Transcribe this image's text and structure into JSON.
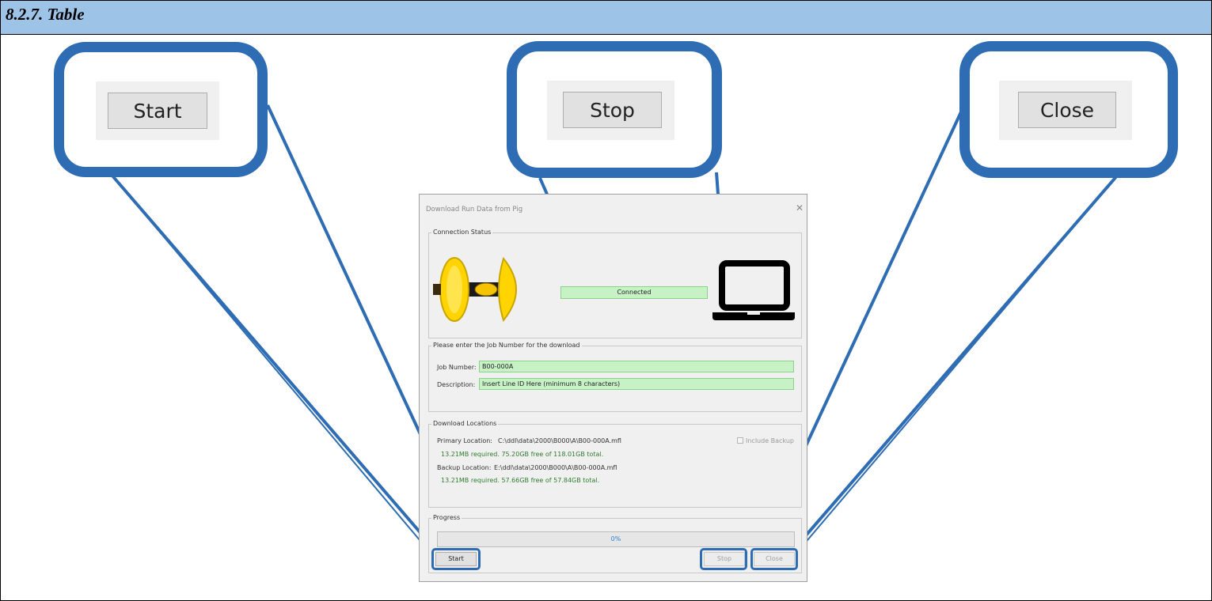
{
  "document": {
    "section_title": "8.2.7. Table"
  },
  "callouts": {
    "start": {
      "button_label": "Start"
    },
    "stop": {
      "button_label": "Stop"
    },
    "close": {
      "button_label": "Close"
    }
  },
  "dialog": {
    "title": "Download Run Data from Pig",
    "close_glyph": "✕",
    "connection": {
      "group_label": "Connection Status",
      "status": "Connected",
      "device_icon": "pig-device-image",
      "computer_icon": "laptop-icon"
    },
    "job": {
      "group_label": "Please enter the Job Number for the download",
      "job_number_label": "Job Number:",
      "job_number_value": "B00-000A",
      "description_label": "Description:",
      "description_value": "Insert Line ID Here (minimum 8 characters)"
    },
    "locations": {
      "group_label": "Download Locations",
      "primary_label": "Primary Location:",
      "primary_path": "C:\\ddl\\data\\2000\\B000\\A\\B00-000A.mfl",
      "primary_space": "13.21MB required. 75.20GB free of 118.01GB total.",
      "include_backup_label": "Include Backup",
      "include_backup_checked": false,
      "backup_label": "Backup Location:",
      "backup_path": "E:\\ddl\\data\\2000\\B000\\A\\B00-000A.mfl",
      "backup_space": "13.21MB required. 57.66GB free of 57.84GB total."
    },
    "progress": {
      "group_label": "Progress",
      "percent_text": "0%",
      "fill_fraction": 0
    },
    "buttons": {
      "start": "Start",
      "stop": "Stop",
      "close": "Close"
    }
  },
  "colors": {
    "callout_border": "#2e6db3",
    "title_bar": "#9dc3e6",
    "field_green": "#c6f2c6"
  }
}
